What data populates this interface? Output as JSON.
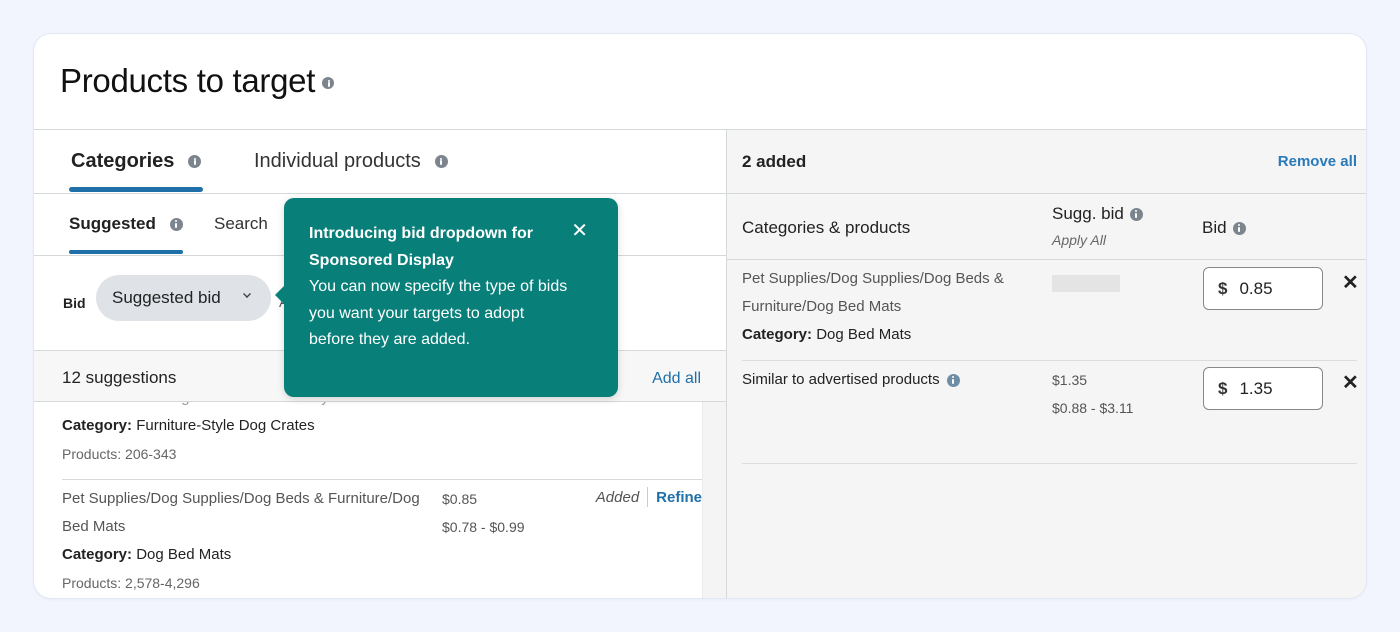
{
  "page": {
    "title": "Products to target",
    "title_icon": "info-icon"
  },
  "tabs": [
    {
      "label": "Categories",
      "active": true,
      "icon": "info-icon"
    },
    {
      "label": "Individual products",
      "active": false,
      "icon": "info-icon"
    }
  ],
  "subtabs": [
    {
      "label": "Suggested",
      "active": true,
      "icon": "info-icon"
    },
    {
      "label": "Search",
      "active": false
    }
  ],
  "bid": {
    "label": "Bid",
    "selected": "Suggested bid",
    "hint": "A"
  },
  "suggestions": {
    "count_label": "12 suggestions",
    "add_all": "Add all",
    "items": [
      {
        "path": "Homes & Pets/Dog Crates/Furniture-Style ...",
        "category_label": "Category:",
        "category": "Furniture-Style Dog Crates",
        "products": "Products: 206-343"
      },
      {
        "path": "Pet Supplies/Dog Supplies/Dog Beds & Furniture/Dog Bed Mats",
        "category_label": "Category:",
        "category": "Dog Bed Mats",
        "products": "Products: 2,578-4,296",
        "sugg_bid": "$0.85",
        "sugg_range": "$0.78 - $0.99",
        "status": "Added",
        "action": "Refine"
      }
    ]
  },
  "popover": {
    "title": "Introducing bid dropdown for Sponsored Display",
    "body": "You can now specify the type of bids you want your targets to adopt before they are added.",
    "close_icon": "close-icon",
    "color": "#087f79"
  },
  "added": {
    "count_label": "2 added",
    "remove_all": "Remove all",
    "columns": {
      "categories": "Categories & products",
      "sugg_bid": "Sugg. bid",
      "apply_all": "Apply All",
      "bid": "Bid"
    },
    "rows": [
      {
        "path": "Pet Supplies/Dog Supplies/Dog Beds & Furniture/Dog Bed Mats",
        "category_label": "Category:",
        "category": "Dog Bed Mats",
        "sugg_bid": "",
        "currency": "$",
        "bid": "0.85"
      },
      {
        "label": "Similar to advertised products",
        "sugg_bid": "$1.35",
        "sugg_range": "$0.88 - $3.11",
        "currency": "$",
        "bid": "1.35"
      }
    ]
  },
  "colors": {
    "accent_link": "#1f6fa8",
    "tab_underline": "#1f6fa8",
    "popover_bg": "#087f79",
    "page_bg": "#f2f5fd"
  }
}
